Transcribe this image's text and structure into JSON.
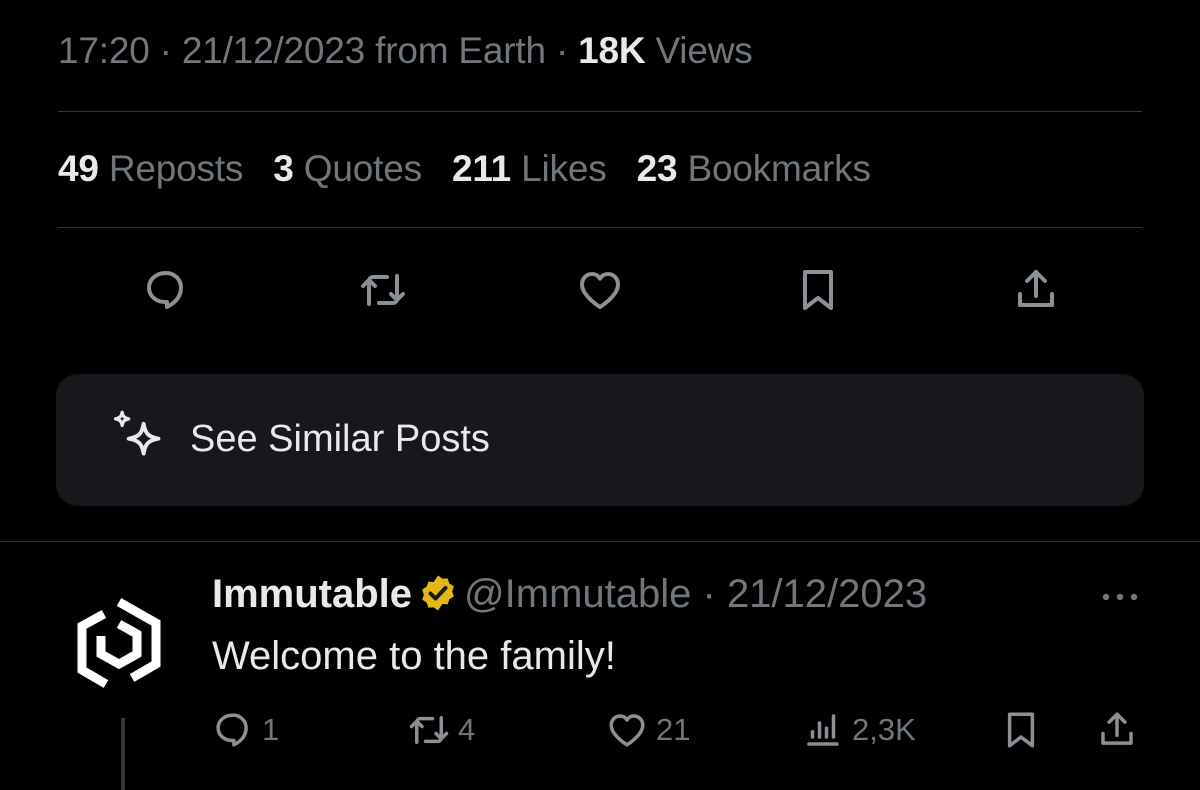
{
  "meta": {
    "time": "17:20",
    "sep1": " · ",
    "date": "21/12/2023",
    "source": " from Earth",
    "sep2": " · ",
    "views_count": "18K",
    "views_label": " Views"
  },
  "stats": [
    {
      "count": "49",
      "label": "Reposts"
    },
    {
      "count": "3",
      "label": "Quotes"
    },
    {
      "count": "211",
      "label": "Likes"
    },
    {
      "count": "23",
      "label": "Bookmarks"
    }
  ],
  "actions": [
    "reply-icon",
    "repost-icon",
    "like-icon",
    "bookmark-icon",
    "share-icon"
  ],
  "similar": {
    "label": "See Similar Posts",
    "icon": "sparkle-icon"
  },
  "reply": {
    "name": "Immutable",
    "verified_color": "#e2b719",
    "handle": "@Immutable",
    "sep": " · ",
    "date": "21/12/2023",
    "text": "Welcome to the family!",
    "replies": "1",
    "reposts": "4",
    "likes": "21",
    "views": "2,3K"
  },
  "colors": {
    "background": "#000000",
    "text": "#e7e9ea",
    "muted": "#71767b",
    "card": "#16181c"
  }
}
